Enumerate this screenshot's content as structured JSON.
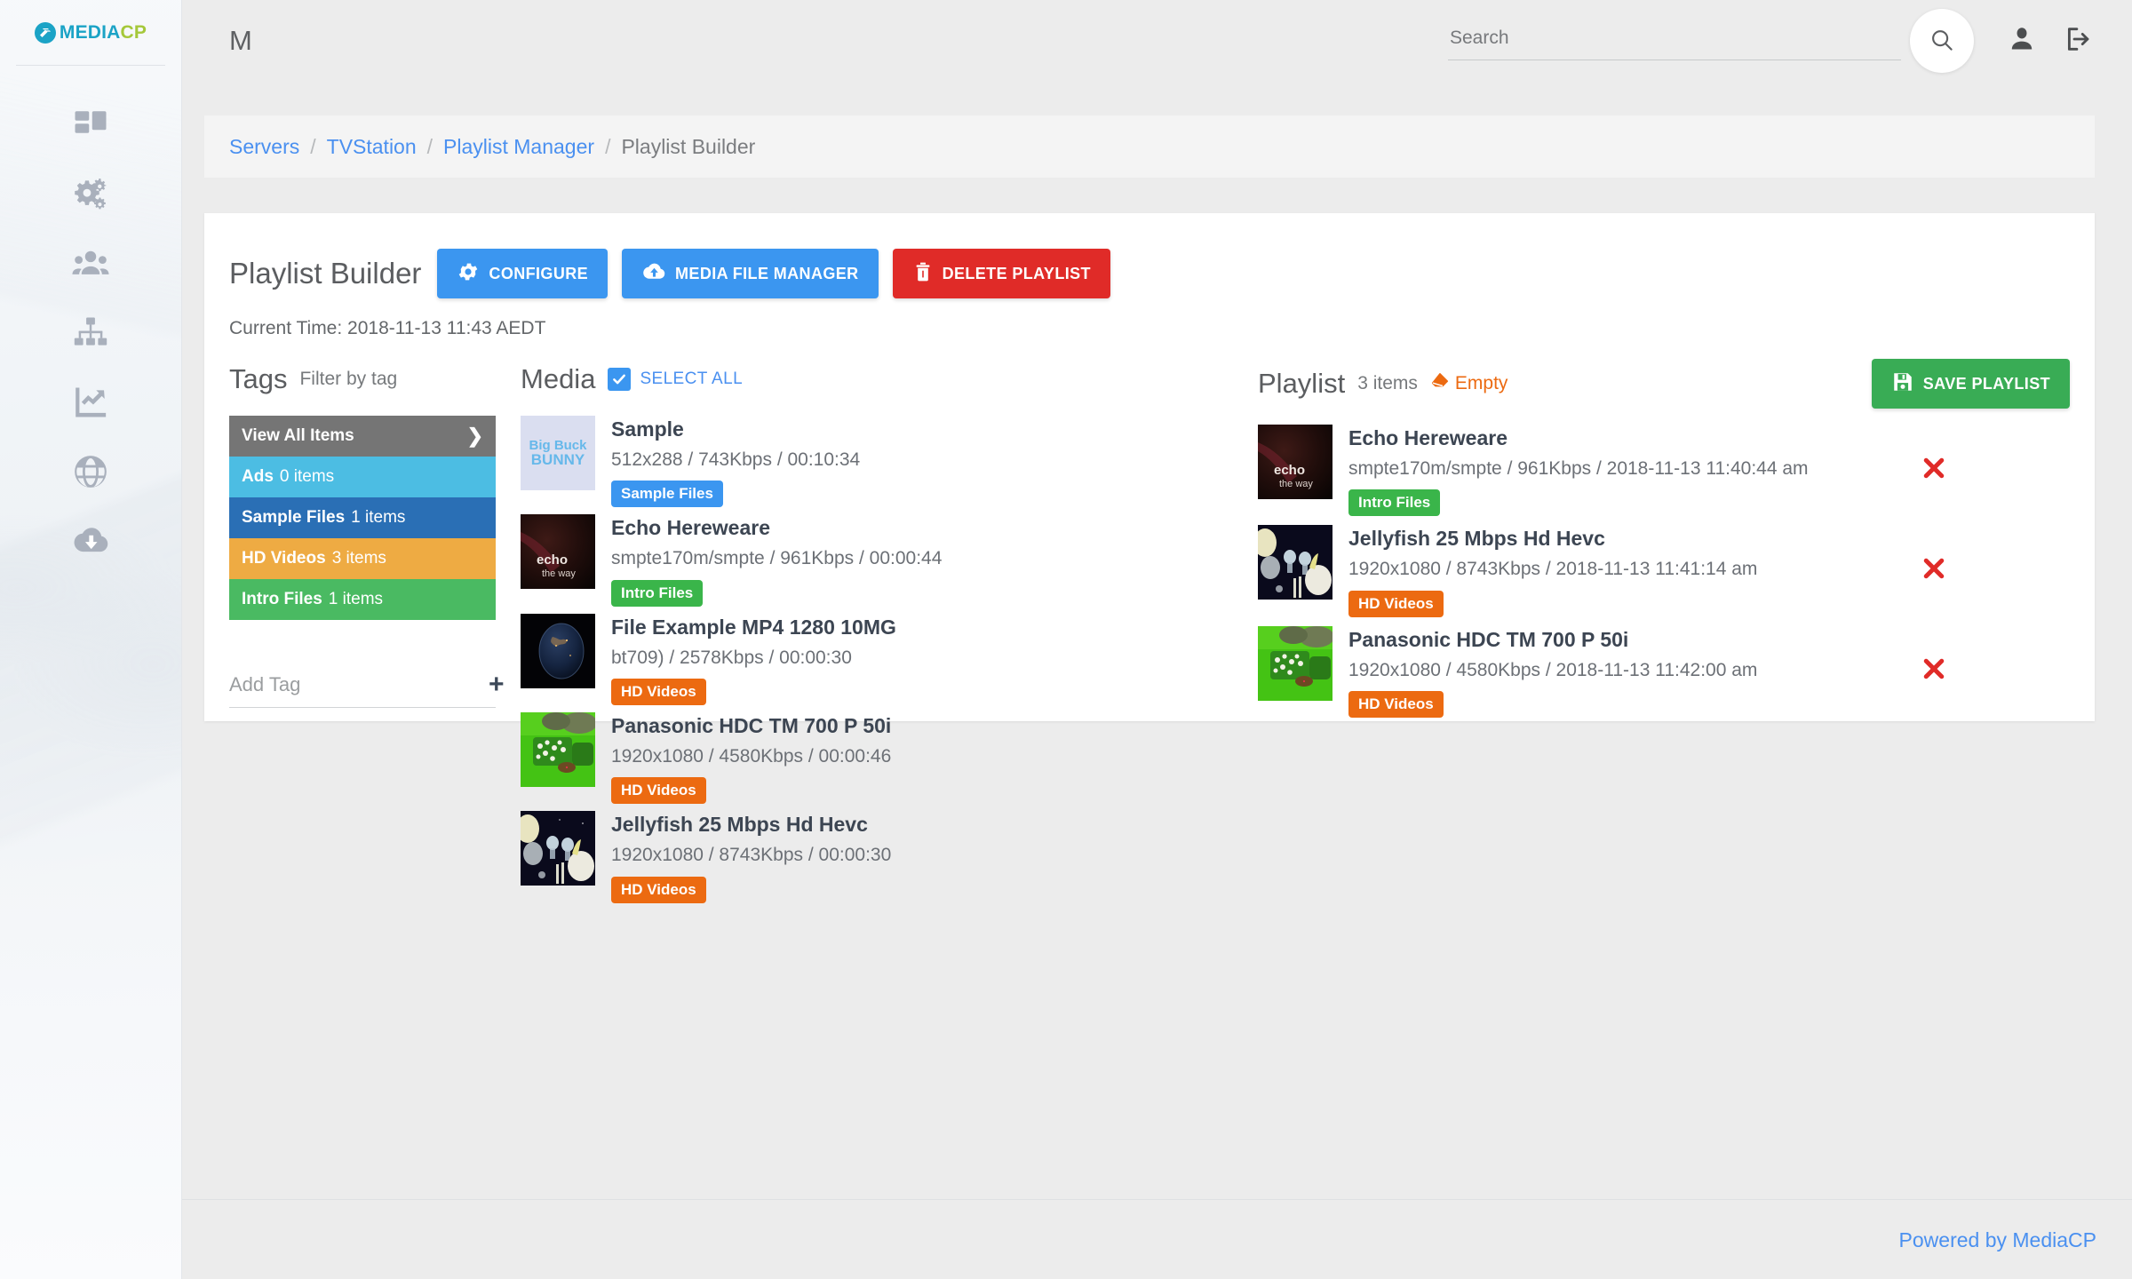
{
  "brand": {
    "name_a": "MEDIA",
    "name_b": "CP",
    "logo_icon": "mediacp-logo-icon"
  },
  "sidebar": {
    "items": [
      {
        "icon": "dashboard-grid-icon",
        "name": "dashboard"
      },
      {
        "icon": "gears-settings-icon",
        "name": "settings"
      },
      {
        "icon": "users-group-icon",
        "name": "users"
      },
      {
        "icon": "sitemap-hierarchy-icon",
        "name": "servers"
      },
      {
        "icon": "chart-line-up-icon",
        "name": "statistics"
      },
      {
        "icon": "globe-icon",
        "name": "network"
      },
      {
        "icon": "cloud-download-icon",
        "name": "downloads"
      }
    ]
  },
  "topbar": {
    "app_title": "M",
    "search_placeholder": "Search",
    "search_value": "",
    "search_icon": "search-icon",
    "profile_icon": "user-icon",
    "logout_icon": "logout-icon"
  },
  "breadcrumb": {
    "items": [
      "Servers",
      "TVStation",
      "Playlist Manager"
    ],
    "separator": "/",
    "current": "Playlist Builder"
  },
  "page": {
    "title": "Playlist Builder",
    "current_time_label": "Current Time: 2018-11-13 11:43 AEDT",
    "buttons": [
      {
        "label": "CONFIGURE",
        "icon": "gear-icon",
        "color": "#3b96f0",
        "style": "btn-blue",
        "name": "configure-button"
      },
      {
        "label": "MEDIA FILE MANAGER",
        "icon": "cloud-upload-icon",
        "color": "#3b96f0",
        "style": "btn-blue",
        "name": "media-file-manager-button"
      },
      {
        "label": "DELETE PLAYLIST",
        "icon": "trash-icon",
        "color": "#e02b28",
        "style": "btn-red",
        "name": "delete-playlist-button"
      }
    ]
  },
  "tags_panel": {
    "heading": "Tags",
    "subheading": "Filter by tag",
    "view_all_label": "View All Items",
    "view_all_chevron": "chevron-right-icon",
    "view_all_color": "#757575",
    "tags": [
      {
        "name": "Ads",
        "count": "0 items",
        "color": "#4cbde3"
      },
      {
        "name": "Sample Files",
        "count": "1 items",
        "color": "#2a6fb5"
      },
      {
        "name": "HD Videos",
        "count": "3 items",
        "color": "#eeab43"
      },
      {
        "name": "Intro Files",
        "count": "1 items",
        "color": "#4aba62"
      }
    ],
    "add_tag_placeholder": "Add Tag",
    "add_tag_value": "",
    "add_tag_icon": "plus-icon"
  },
  "media_panel": {
    "heading": "Media",
    "select_all_label": "SELECT ALL",
    "select_all_checked": true,
    "items": [
      {
        "title": "Sample",
        "meta": "512x288 / 743Kbps / 00:10:34",
        "tag": "Sample Files",
        "tag_color": "#3b96f0",
        "thumb": "big-buck-bunny-thumbnail"
      },
      {
        "title": "Echo Hereweare",
        "meta": "smpte170m/smpte / 961Kbps / 00:00:44",
        "tag": "Intro Files",
        "tag_color": "#3ab54a",
        "thumb": "echo-the-way-thumbnail"
      },
      {
        "title": "File Example MP4 1280 10MG",
        "meta": "bt709) / 2578Kbps / 00:00:30",
        "tag": "HD Videos",
        "tag_color": "#ec6a11",
        "thumb": "earth-space-thumbnail"
      },
      {
        "title": "Panasonic HDC TM 700 P 50i",
        "meta": "1920x1080 / 4580Kbps / 00:00:46",
        "tag": "HD Videos",
        "tag_color": "#ec6a11",
        "thumb": "mushrooms-grass-thumbnail"
      },
      {
        "title": "Jellyfish 25 Mbps Hd Hevc",
        "meta": "1920x1080 / 8743Kbps / 00:00:30",
        "tag": "HD Videos",
        "tag_color": "#ec6a11",
        "thumb": "jellyfish-thumbnail"
      }
    ]
  },
  "playlist_panel": {
    "heading": "Playlist",
    "count_label": "3 items",
    "empty_label": "Empty",
    "empty_icon": "eraser-icon",
    "save_label": "SAVE PLAYLIST",
    "save_icon": "floppy-save-icon",
    "delete_icon": "red-x-icon",
    "items": [
      {
        "title": "Echo Hereweare",
        "meta": "smpte170m/smpte / 961Kbps / 2018-11-13 11:40:44 am",
        "tag": "Intro Files",
        "tag_color": "#3ab54a",
        "thumb": "echo-the-way-thumbnail"
      },
      {
        "title": "Jellyfish 25 Mbps Hd Hevc",
        "meta": "1920x1080 / 8743Kbps / 2018-11-13 11:41:14 am",
        "tag": "HD Videos",
        "tag_color": "#ec6a11",
        "thumb": "jellyfish-thumbnail"
      },
      {
        "title": "Panasonic HDC TM 700 P 50i",
        "meta": "1920x1080 / 4580Kbps / 2018-11-13 11:42:00 am",
        "tag": "HD Videos",
        "tag_color": "#ec6a11",
        "thumb": "mushrooms-grass-thumbnail"
      }
    ]
  },
  "footer": {
    "text": "Powered by MediaCP"
  }
}
